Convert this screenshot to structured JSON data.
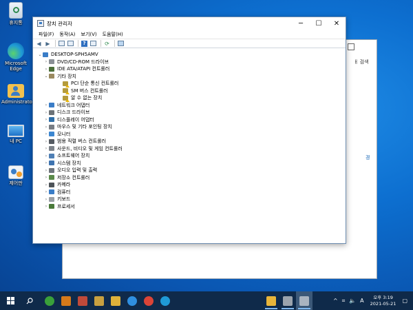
{
  "desktop": {
    "icons": [
      {
        "label": "휴지통",
        "icon": "recycle-bin-icon"
      },
      {
        "label": "Microsoft Edge",
        "icon": "edge-icon"
      },
      {
        "label": "Administrator",
        "icon": "user-folder-icon"
      },
      {
        "label": "내 PC",
        "icon": "this-pc-icon"
      },
      {
        "label": "제어판",
        "icon": "control-panel-icon"
      }
    ]
  },
  "back_window": {
    "text_fragment": "ㅐ 검색",
    "link_fragment": "경"
  },
  "window": {
    "title": "장치 관리자",
    "controls": {
      "minimize": "─",
      "maximize": "☐",
      "close": "✕"
    },
    "menu": [
      "파일(F)",
      "동작(A)",
      "보기(V)",
      "도움말(H)"
    ]
  },
  "tree": {
    "root": "DESKTOP-SPH5AMV",
    "items": [
      {
        "label": "DVD/CD-ROM 드라이브",
        "level": 1,
        "expand": "›",
        "icon": "dvd-drive-icon",
        "color": "#8a8f96"
      },
      {
        "label": "IDE ATA/ATAPI 컨트롤러",
        "level": 1,
        "expand": "›",
        "icon": "ide-controller-icon",
        "color": "#4b6f3a"
      },
      {
        "label": "기타 장치",
        "level": 1,
        "expand": "⌄",
        "icon": "other-devices-icon",
        "color": "#9a8a60"
      },
      {
        "label": "PCI 단순 통신 컨트롤러",
        "level": 2,
        "expand": "",
        "icon": "unknown-device-warning-icon",
        "color": "#b59b3b"
      },
      {
        "label": "SM 버스 컨트롤러",
        "level": 2,
        "expand": "",
        "icon": "unknown-device-warning-icon",
        "color": "#b59b3b"
      },
      {
        "label": "알 수 없는 장치",
        "level": 2,
        "expand": "",
        "icon": "unknown-device-warning-icon",
        "color": "#b59b3b"
      },
      {
        "label": "네트워크 어댑터",
        "level": 1,
        "expand": "›",
        "icon": "network-adapter-icon",
        "color": "#3a7dc7"
      },
      {
        "label": "디스크 드라이브",
        "level": 1,
        "expand": "›",
        "icon": "disk-drive-icon",
        "color": "#6d7378"
      },
      {
        "label": "디스플레이 어댑터",
        "level": 1,
        "expand": "›",
        "icon": "display-adapter-icon",
        "color": "#2f6fa8"
      },
      {
        "label": "마우스 및 기타 포인팅 장치",
        "level": 1,
        "expand": "›",
        "icon": "mouse-icon",
        "color": "#777d84"
      },
      {
        "label": "모니터",
        "level": 1,
        "expand": "›",
        "icon": "monitor-icon",
        "color": "#3c86d0"
      },
      {
        "label": "범용 직렬 버스 컨트롤러",
        "level": 1,
        "expand": "›",
        "icon": "usb-controller-icon",
        "color": "#555b62"
      },
      {
        "label": "사운드, 비디오 및 게임 컨트롤러",
        "level": 1,
        "expand": "›",
        "icon": "sound-icon",
        "color": "#7d838a"
      },
      {
        "label": "소프트웨어 장치",
        "level": 1,
        "expand": "›",
        "icon": "software-device-icon",
        "color": "#4f7fb5"
      },
      {
        "label": "시스템 장치",
        "level": 1,
        "expand": "›",
        "icon": "system-device-icon",
        "color": "#3f74b0"
      },
      {
        "label": "오디오 입력 및 출력",
        "level": 1,
        "expand": "›",
        "icon": "audio-io-icon",
        "color": "#6f767d"
      },
      {
        "label": "저장소 컨트롤러",
        "level": 1,
        "expand": "›",
        "icon": "storage-controller-icon",
        "color": "#5b8a4a"
      },
      {
        "label": "카메라",
        "level": 1,
        "expand": "›",
        "icon": "camera-icon",
        "color": "#4d5358"
      },
      {
        "label": "컴퓨터",
        "level": 1,
        "expand": "›",
        "icon": "computer-icon",
        "color": "#3a7dc7"
      },
      {
        "label": "키보드",
        "level": 1,
        "expand": "›",
        "icon": "keyboard-icon",
        "color": "#9aa0a6"
      },
      {
        "label": "프로세서",
        "level": 1,
        "expand": "›",
        "icon": "processor-icon",
        "color": "#4a7a3a"
      }
    ]
  },
  "taskbar": {
    "start_icon": "windows-start-icon",
    "search_icon": "search-icon",
    "apps": [
      {
        "icon": "utorrent-icon",
        "color": "#3aa03a"
      },
      {
        "icon": "tool-app-icon",
        "color": "#d67a1a"
      },
      {
        "icon": "eye-app-icon",
        "color": "#c04a3a"
      },
      {
        "icon": "bee-app-icon",
        "color": "#c8a040"
      },
      {
        "icon": "file-explorer-icon",
        "color": "#e0b23a"
      },
      {
        "icon": "ie-icon",
        "color": "#2f8fe0"
      },
      {
        "icon": "chrome-icon",
        "color": "#db4437"
      },
      {
        "icon": "edge-icon",
        "color": "#1f9ad6"
      }
    ],
    "right_apps": [
      {
        "icon": "folder-icon",
        "color": "#e8b53a"
      },
      {
        "icon": "printer-app-icon",
        "color": "#9aa3ad"
      },
      {
        "icon": "device-manager-app-icon",
        "color": "#aab4c0"
      }
    ],
    "tray": {
      "chevron": "^",
      "network": "⌗",
      "volume": "🔈",
      "ime": "A"
    },
    "clock": {
      "time": "오후 3:19",
      "date": "2021-05-21"
    },
    "notification_icon": "▢"
  }
}
